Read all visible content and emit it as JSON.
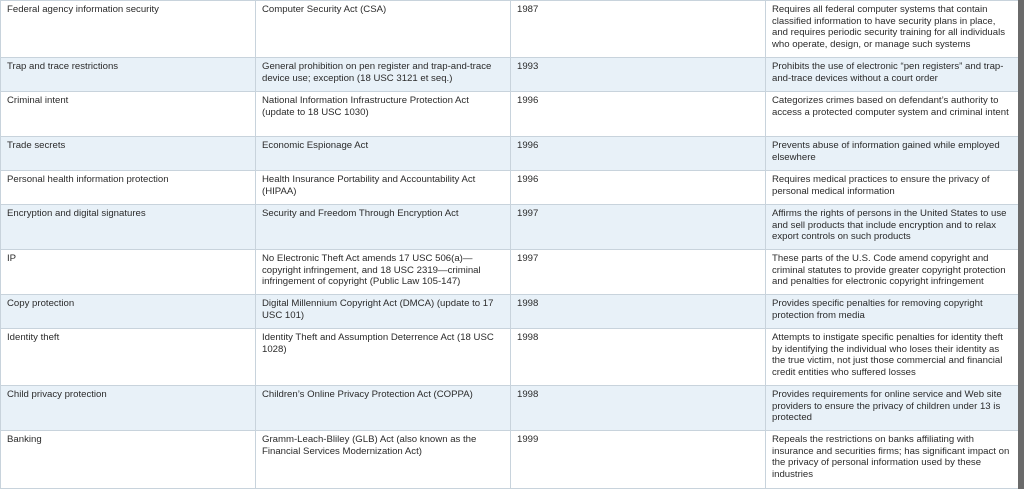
{
  "rows": [
    {
      "area": "Federal agency information security",
      "law": "Computer Security Act (CSA)",
      "year": "1987",
      "description": "Requires all federal computer systems that contain classified information to have security plans in place, and requires periodic security training for all individuals who operate, design, or manage such systems"
    },
    {
      "area": "Trap and trace restrictions",
      "law": "General prohibition on pen register and trap-and-trace device use; exception (18 USC 3121 et seq.)",
      "year": "1993",
      "description": "Prohibits the use of electronic “pen registers” and trap-and-trace devices without a court order"
    },
    {
      "area": "Criminal intent",
      "law": "National Information Infrastructure Protection Act (update to 18 USC 1030)",
      "year": "1996",
      "description": "Categorizes crimes based on defendant’s authority to access a protected computer system and criminal intent"
    },
    {
      "area": "Trade secrets",
      "law": "Economic Espionage Act",
      "year": "1996",
      "description": "Prevents abuse of information gained while employed elsewhere"
    },
    {
      "area": "Personal health information protection",
      "law": "Health Insurance Portability and Accountability Act (HIPAA)",
      "year": "1996",
      "description": "Requires medical practices to ensure the privacy of personal medical information"
    },
    {
      "area": "Encryption and digital signatures",
      "law": "Security and Freedom Through Encryption Act",
      "year": "1997",
      "description": "Affirms the rights of persons in the United States to use and sell products that include encryption and to relax export controls on such products"
    },
    {
      "area": "IP",
      "law": "No Electronic Theft Act amends 17 USC 506(a)—copyright infringement, and 18 USC 2319—criminal infringement of copyright (Public Law 105-147)",
      "year": "1997",
      "description": "These parts of the U.S. Code amend copyright and criminal statutes to provide greater copyright protection and penalties for electronic copyright infringement"
    },
    {
      "area": "Copy protection",
      "law": "Digital Millennium Copyright Act (DMCA) (update to 17 USC 101)",
      "year": "1998",
      "description": "Provides specific penalties for removing copyright protection from media"
    },
    {
      "area": "Identity theft",
      "law": "Identity Theft and Assumption Deterrence Act (18 USC 1028)",
      "year": "1998",
      "description": "Attempts to instigate specific penalties for identity theft by identifying the individual who loses their identity as the true victim, not just those commercial and financial credit entities who suffered losses"
    },
    {
      "area": "Child privacy protection",
      "law": "Children’s Online Privacy Protection Act (COPPA)",
      "year": "1998",
      "description": "Provides requirements for online service and Web site providers to ensure the privacy of children under 13 is protected"
    },
    {
      "area": "Banking",
      "law": "Gramm-Leach-Bliley (GLB) Act (also known as the Financial Services Modernization Act)",
      "year": "1999",
      "description": "Repeals the restrictions on banks affiliating with insurance and securities firms; has significant impact on the privacy of personal information used by these industries"
    }
  ]
}
